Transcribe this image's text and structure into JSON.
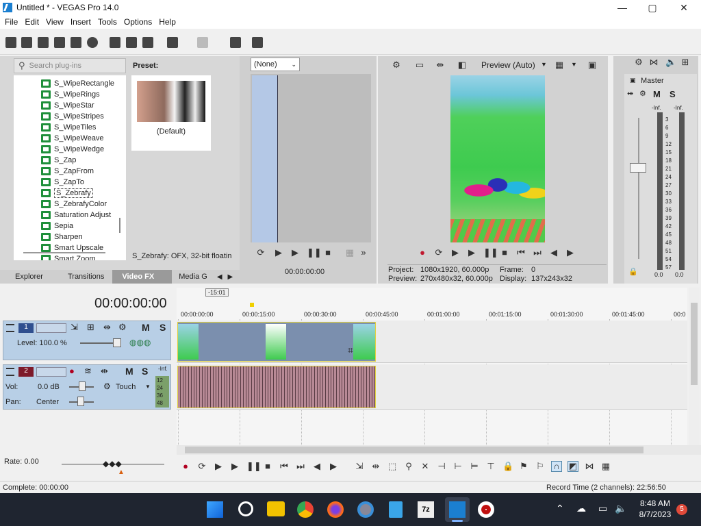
{
  "window": {
    "title": "Untitled * - VEGAS Pro 14.0",
    "minimize": "—",
    "maximize": "▢",
    "close": "✕"
  },
  "menu": [
    "File",
    "Edit",
    "View",
    "Insert",
    "Tools",
    "Options",
    "Help"
  ],
  "plugins": {
    "search_placeholder": "Search plug-ins",
    "items": [
      "S_WipeRectangle",
      "S_WipeRings",
      "S_WipeStar",
      "S_WipeStripes",
      "S_WipeTiles",
      "S_WipeWeave",
      "S_WipeWedge",
      "S_Zap",
      "S_ZapFrom",
      "S_ZapTo",
      "S_Zebrafy",
      "S_ZebrafyColor",
      "Saturation Adjust",
      "Sepia",
      "Sharpen",
      "Smart Upscale",
      "Smart Zoom"
    ],
    "selected": "S_Zebrafy"
  },
  "preset": {
    "label": "Preset:",
    "default_label": "(Default)",
    "description": "S_Zebrafy: OFX, 32-bit floatin"
  },
  "tabs": [
    "Explorer",
    "Transitions",
    "Video FX",
    "Media G"
  ],
  "trimmer": {
    "select_value": "(None)",
    "timecode": "00:00:00:00"
  },
  "preview": {
    "mode_label": "Preview (Auto)",
    "project": "Project:",
    "project_val": "1080x1920, 60.000p",
    "preview": "Preview:",
    "preview_val": "270x480x32, 60.000p",
    "frame": "Frame:",
    "frame_val": "0",
    "display": "Display:",
    "display_val": "137x243x32"
  },
  "mixer": {
    "title": "Master",
    "m": "M",
    "s": "S",
    "inf_left": "-Inf.",
    "inf_right": "-Inf.",
    "scale": [
      "3",
      "6",
      "9",
      "12",
      "15",
      "18",
      "21",
      "24",
      "27",
      "30",
      "33",
      "36",
      "39",
      "42",
      "45",
      "48",
      "51",
      "54",
      "57"
    ],
    "bottom_left": "0.0",
    "bottom_right": "0.0"
  },
  "timeline": {
    "timecode": "00:00:00:00",
    "marker": "-15:01",
    "ruler": [
      "00:00:00:00",
      "00:00:15:00",
      "00:00:30:00",
      "00:00:45:00",
      "00:01:00:00",
      "00:01:15:00",
      "00:01:30:00",
      "00:01:45:00",
      "00:0"
    ]
  },
  "track1": {
    "num": "1",
    "m": "M",
    "s": "S",
    "level": "Level: 100.0 %"
  },
  "track2": {
    "num": "2",
    "m": "M",
    "s": "S",
    "vol_label": "Vol:",
    "vol_val": "0.0 dB",
    "pan_label": "Pan:",
    "pan_val": "Center",
    "touch": "Touch",
    "inf": "-Inf.",
    "meters": [
      "12",
      "24",
      "36",
      "48"
    ]
  },
  "rate": "Rate: 0.00",
  "status": {
    "complete": "Complete: 00:00:00",
    "record": "Record Time (2 channels): 22:56:50"
  },
  "taskbar": {
    "time": "8:48 AM",
    "date": "8/7/2023",
    "badge": "5"
  }
}
